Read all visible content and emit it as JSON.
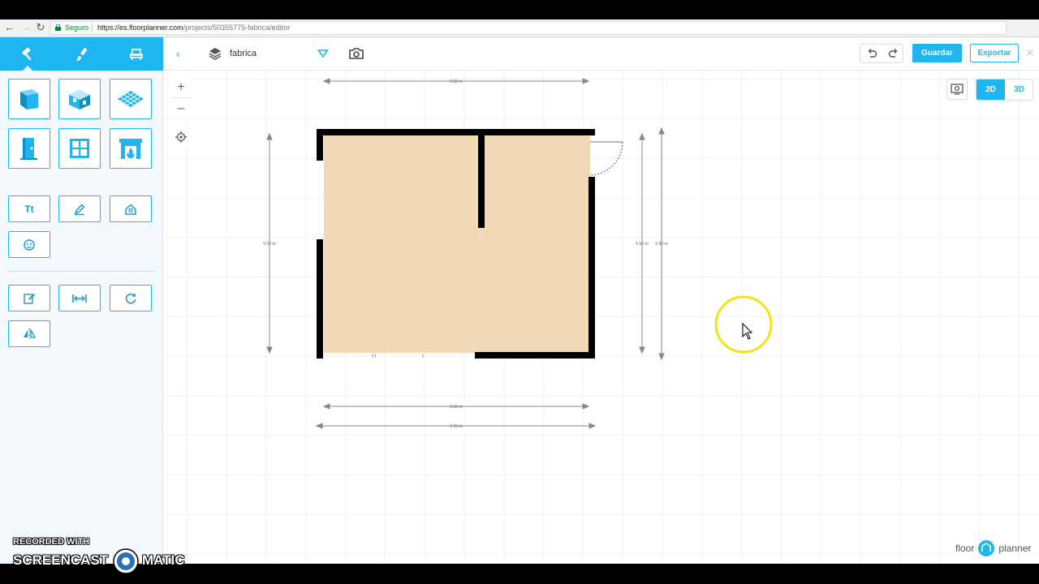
{
  "browser": {
    "secure_label": "Seguro",
    "url_host": "https://es.floorplanner.com",
    "url_path": "/projects/50355775-fabrica/editor"
  },
  "sidebar": {
    "tabs": [
      {
        "icon": "hammer-icon",
        "active": true
      },
      {
        "icon": "paintbrush-icon",
        "active": false
      },
      {
        "icon": "armchair-icon",
        "active": false
      }
    ],
    "tools": [
      {
        "icon": "wall-icon"
      },
      {
        "icon": "room-icon"
      },
      {
        "icon": "floor-surface-icon"
      },
      {
        "icon": "door-icon"
      },
      {
        "icon": "window-icon"
      },
      {
        "icon": "fireplace-icon"
      },
      {
        "icon": "text-icon",
        "label": "Tt"
      },
      {
        "icon": "pencil-icon"
      },
      {
        "icon": "house-pin-icon"
      },
      {
        "icon": "emoji-icon"
      },
      {
        "icon": "edit-icon"
      },
      {
        "icon": "dimension-icon"
      },
      {
        "icon": "rotate-icon"
      },
      {
        "icon": "flip-icon"
      }
    ]
  },
  "topbar": {
    "project_name": "fabrica",
    "save_label": "Guardar",
    "export_label": "Exportar"
  },
  "canvas": {
    "view_2d_label": "2D",
    "view_3d_label": "3D",
    "dimensions": {
      "top": "6.60 m",
      "left": "5.50 m",
      "right_inner": "5.50 m",
      "right_outer": "5.80 m",
      "bottom_inner": "6.60 m",
      "bottom_outer": "6.90 m"
    },
    "colors": {
      "room_fill": "#f1d9b5",
      "wall": "#000000",
      "accent": "#1eb5f0",
      "cursor_highlight": "#f2e21a"
    }
  },
  "branding": {
    "logo_left": "floor",
    "logo_right": "planner"
  },
  "watermark": {
    "recorded_with": "RECORDED WITH",
    "brand_left": "SCREENCAST",
    "brand_right": "MATIC"
  }
}
